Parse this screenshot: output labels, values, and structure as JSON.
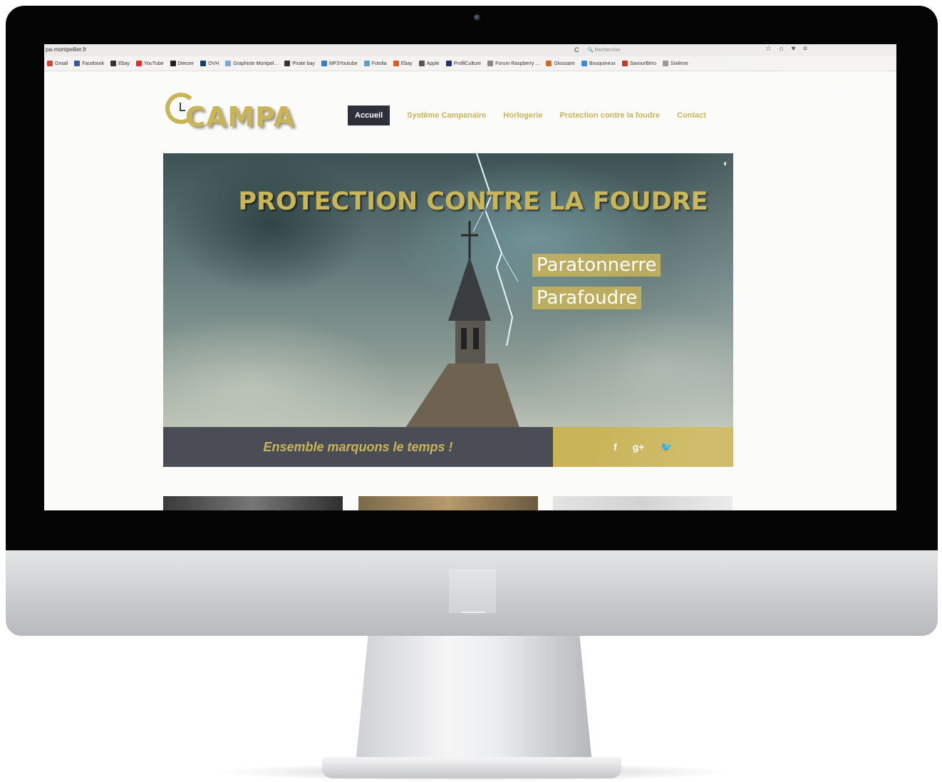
{
  "browser": {
    "url": "pa-montpellier.fr",
    "reload_glyph": "C",
    "search_placeholder": "🔍 Rechercher",
    "toolbar_glyphs": "☆ ⌂ ♥ ≡",
    "bookmarks": [
      {
        "label": "Gmail",
        "color": "#d44638"
      },
      {
        "label": "Facebook",
        "color": "#3b5998"
      },
      {
        "label": "Ebay",
        "color": "#333333"
      },
      {
        "label": "YouTube",
        "color": "#e52d27"
      },
      {
        "label": "Deezer",
        "color": "#222222"
      },
      {
        "label": "OVH",
        "color": "#123f6d"
      },
      {
        "label": "Graphiste Montpel...",
        "color": "#7aa8d8"
      },
      {
        "label": "Pirate bay",
        "color": "#333333"
      },
      {
        "label": "MP3Youtube",
        "color": "#3a7ac0"
      },
      {
        "label": "Fotolia",
        "color": "#5aa0d0"
      },
      {
        "label": "Ebay",
        "color": "#e05a20"
      },
      {
        "label": "Apple",
        "color": "#555555"
      },
      {
        "label": "ProfilCulture",
        "color": "#223366"
      },
      {
        "label": "Forum Raspberry ...",
        "color": "#888888"
      },
      {
        "label": "Glossaire",
        "color": "#d46a2a"
      },
      {
        "label": "Bouquineux",
        "color": "#3a8ad0"
      },
      {
        "label": "SavourBéro",
        "color": "#c0392b"
      },
      {
        "label": "Sixième",
        "color": "#999999"
      }
    ]
  },
  "site": {
    "logo_text": "CAMPA",
    "nav": [
      "Accueil",
      "Système Campanaire",
      "Horlogerie",
      "Protection contre la foudre",
      "Contact"
    ],
    "hero": {
      "title": "PROTECTION CONTRE LA FOUDRE",
      "tags": [
        "Paratonnerre",
        "Parafoudre"
      ]
    },
    "slogan": "Ensemble marquons le temps !",
    "social": {
      "facebook": "f",
      "googleplus": "g+",
      "twitter": "🐦"
    }
  },
  "colors": {
    "accent": "#c9b458",
    "dark": "#2d3038",
    "bar": "#4a4d55"
  }
}
